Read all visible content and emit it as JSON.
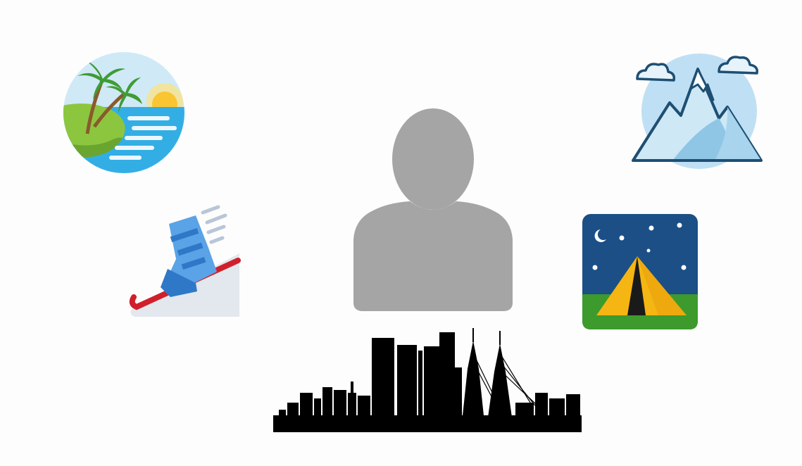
{
  "scene": {
    "background": "#ffffff",
    "center": {
      "icon": "person-silhouette-icon",
      "color": "#a5a5a5"
    },
    "interests": [
      {
        "icon": "beach-island-icon"
      },
      {
        "icon": "ski-boot-icon"
      },
      {
        "icon": "snowy-mountain-icon"
      },
      {
        "icon": "camping-tent-night-icon"
      }
    ],
    "bottom": {
      "icon": "city-skyline-icon",
      "color": "#000000"
    }
  }
}
